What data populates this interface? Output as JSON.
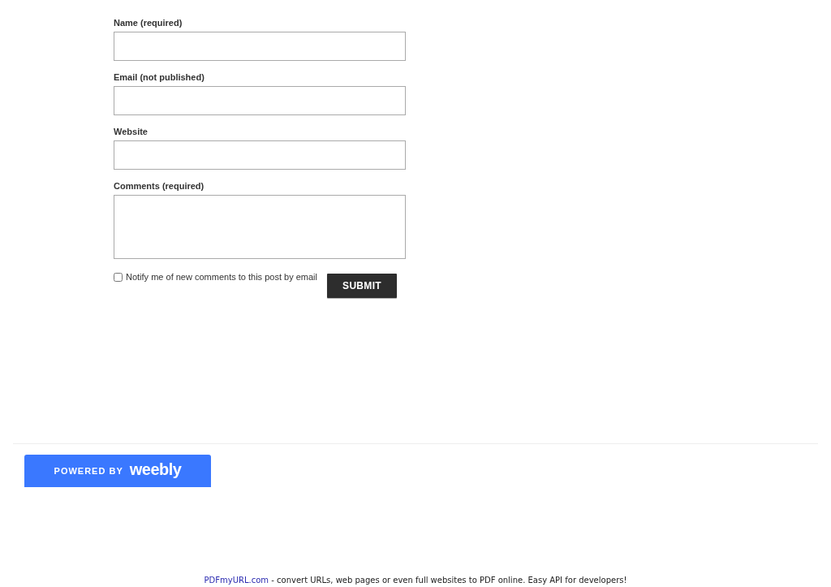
{
  "form": {
    "fields": [
      {
        "label": "Name (required)",
        "kind": "text"
      },
      {
        "label": "Email (not published)",
        "kind": "text"
      },
      {
        "label": "Website",
        "kind": "text"
      },
      {
        "label": "Comments (required)",
        "kind": "textarea"
      }
    ],
    "notify": {
      "label": "Notify me of new comments to this post by email",
      "checked": false
    },
    "submit": "SUBMIT"
  },
  "badge": {
    "prefix": "POWERED BY",
    "brand": "weebly"
  },
  "footer": {
    "link": "PDFmyURL.com",
    "text": " - convert URLs, web pages or even full websites to PDF online. Easy API for developers!"
  }
}
